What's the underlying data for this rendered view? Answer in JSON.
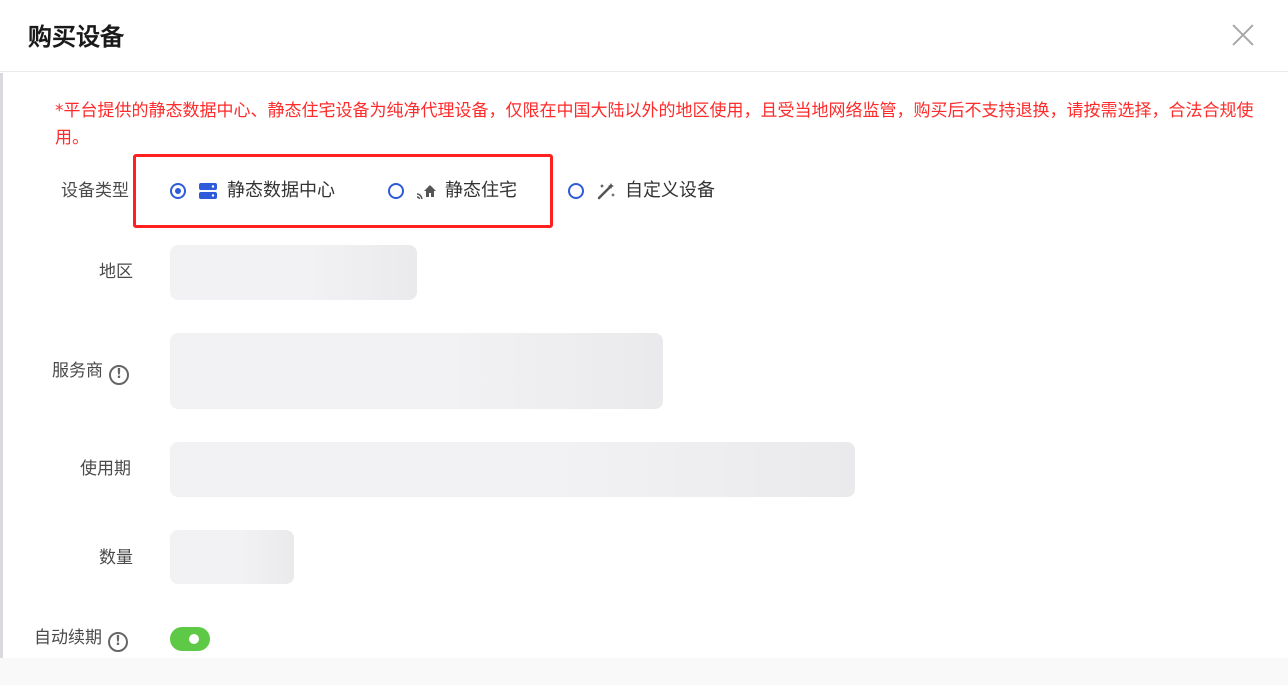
{
  "dialog": {
    "title": "购买设备",
    "notice": "*平台提供的静态数据中心、静态住宅设备为纯净代理设备，仅限在中国大陆以外的地区使用，且受当地网络监管，购买后不支持退换，请按需选择，合法合规使用。"
  },
  "form": {
    "device_type": {
      "label": "设备类型",
      "options": [
        {
          "label": "静态数据中心",
          "icon": "server-icon",
          "selected": true
        },
        {
          "label": "静态住宅",
          "icon": "residential-icon",
          "selected": false
        },
        {
          "label": "自定义设备",
          "icon": "magic-wand-icon",
          "selected": false
        }
      ]
    },
    "region": {
      "label": "地区"
    },
    "provider": {
      "label": "服务商",
      "info_icon": "!"
    },
    "period": {
      "label": "使用期"
    },
    "quantity": {
      "label": "数量"
    },
    "auto_renew": {
      "label": "自动续期",
      "info_icon": "!",
      "enabled": true
    }
  },
  "colors": {
    "accent": "#2d5bd9",
    "notice": "#ff2a2a",
    "highlight": "#ff2020",
    "toggle_on": "#5ec946"
  }
}
